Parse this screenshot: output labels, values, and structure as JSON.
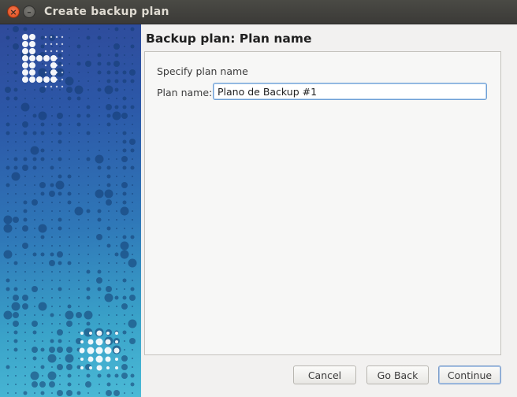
{
  "window": {
    "title": "Create backup plan",
    "close_glyph": "×",
    "minimize_glyph": "–"
  },
  "page": {
    "title": "Backup plan: Plan name"
  },
  "form": {
    "heading": "Specify plan name",
    "plan_name_label": "Plan name:",
    "plan_name_value": "Plano de Backup #1"
  },
  "buttons": {
    "cancel": "Cancel",
    "go_back": "Go Back",
    "continue": "Continue"
  },
  "colors": {
    "titlebar": "#3b3a37",
    "close_button": "#dd4814",
    "side_panel_top": "#2f4a9a",
    "side_panel_bottom": "#4bbad6",
    "input_focus_border": "#6fa0d6"
  }
}
